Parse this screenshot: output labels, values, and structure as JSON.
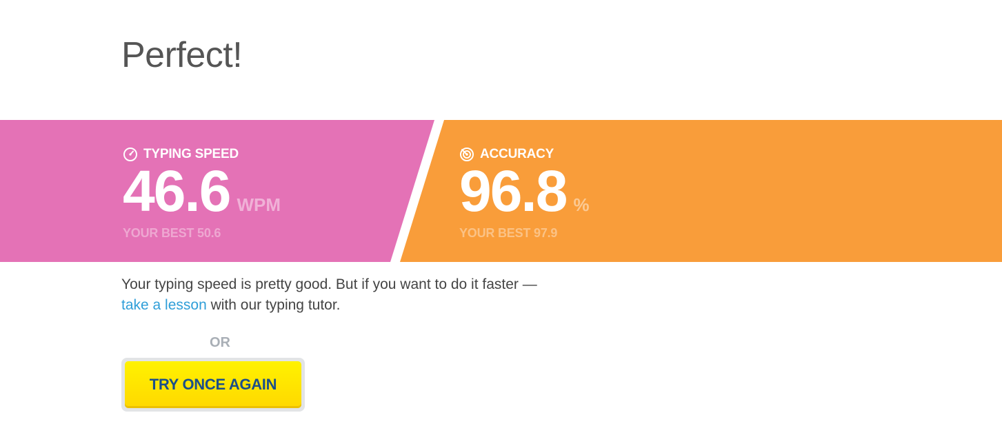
{
  "header": {
    "title": "Perfect!"
  },
  "stats": {
    "speed": {
      "icon": "speedometer-icon",
      "label": "TYPING SPEED",
      "value": "46.6",
      "unit": "WPM",
      "best": "YOUR BEST 50.6",
      "color": "#e472b6"
    },
    "accuracy": {
      "icon": "target-icon",
      "label": "ACCURACY",
      "value": "96.8",
      "unit": "%",
      "best": "YOUR BEST 97.9",
      "color": "#f99d3a"
    }
  },
  "message": {
    "text_before": "Your typing speed is pretty good. But if you want to do it faster — ",
    "link_text": "take a lesson",
    "text_after": " with our typing tutor.",
    "link_color": "#2f9ed8"
  },
  "or_label": "OR",
  "retry_button": {
    "label": "TRY ONCE AGAIN",
    "bg_color": "#ffe600",
    "text_color": "#1b4f8a"
  }
}
